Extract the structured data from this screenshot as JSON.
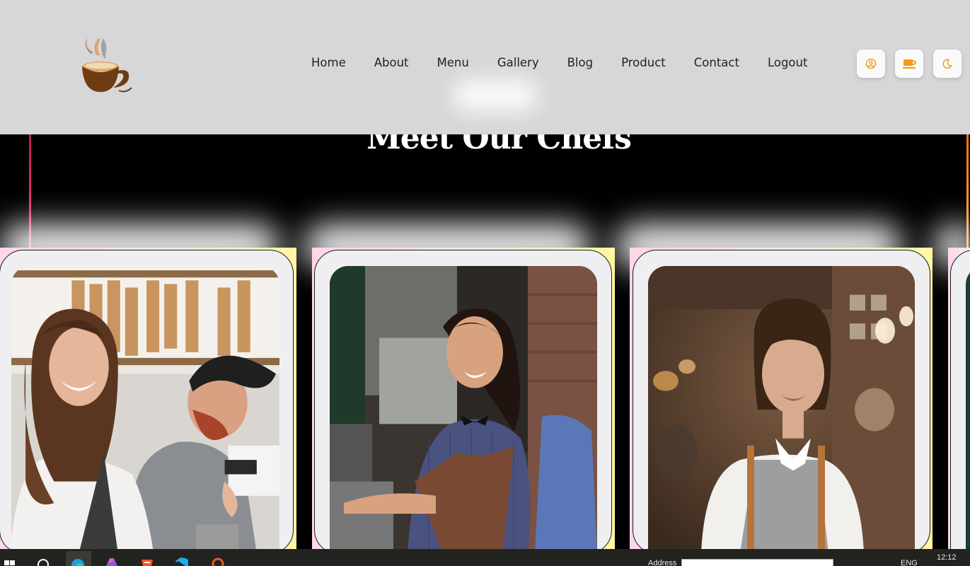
{
  "header": {
    "logo_icon": "coffee-cup-logo-icon",
    "nav": [
      {
        "label": "Home"
      },
      {
        "label": "About"
      },
      {
        "label": "Menu"
      },
      {
        "label": "Gallery"
      },
      {
        "label": "Blog"
      },
      {
        "label": "Product"
      },
      {
        "label": "Contact"
      },
      {
        "label": "Logout"
      }
    ],
    "action_icons": [
      "user-icon",
      "cart-icon",
      "moon-icon"
    ],
    "accent_color": "#f39c12"
  },
  "section": {
    "title": "Meet Our Chefs",
    "cards": [
      {
        "photo": "barista-woman-with-man-photo"
      },
      {
        "photo": "barista-woman-at-machine-photo"
      },
      {
        "photo": "barista-woman-in-cafe-photo"
      }
    ]
  },
  "taskbar": {
    "icons": [
      "windows-start-icon",
      "search-icon",
      "edge-icon",
      "copilot-icon",
      "brave-icon",
      "vscode-icon",
      "app-icon"
    ],
    "address_label": "Address",
    "language": "ENG",
    "time": "12:12"
  }
}
